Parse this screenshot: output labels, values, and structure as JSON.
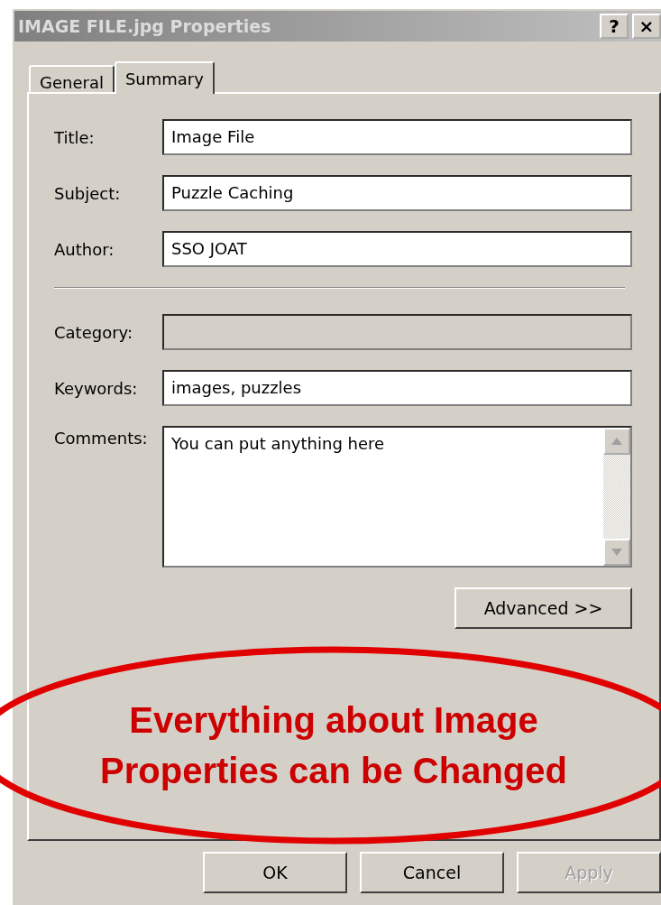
{
  "window": {
    "title": "IMAGE FILE.jpg Properties",
    "title_buttons": [
      "?",
      "×"
    ]
  },
  "tabs": [
    {
      "label": "General",
      "selected": false
    },
    {
      "label": "Summary",
      "selected": true
    }
  ],
  "fields": [
    {
      "kind": "text",
      "label": "Title:",
      "value": "Image File",
      "disabled": false
    },
    {
      "kind": "text",
      "label": "Subject:",
      "value": "Puzzle Caching",
      "disabled": false
    },
    {
      "kind": "text",
      "label": "Author:",
      "value": "SSO JOAT",
      "disabled": false
    },
    {
      "kind": "separator"
    },
    {
      "kind": "text",
      "label": "Category:",
      "disabled": true
    },
    {
      "kind": "text",
      "label": "Keywords:",
      "value": "images, puzzles",
      "disabled": false
    },
    {
      "kind": "textarea",
      "label": "Comments:",
      "value": "You can put anything here",
      "disabled": false
    }
  ],
  "advanced_button": "Advanced >>",
  "annotation": {
    "lines": [
      "Everything about Image",
      "Properties can be Changed"
    ]
  },
  "buttons": [
    {
      "label": "OK",
      "disabled": false
    },
    {
      "label": "Cancel",
      "disabled": false
    },
    {
      "label": "Apply",
      "disabled": true
    }
  ]
}
